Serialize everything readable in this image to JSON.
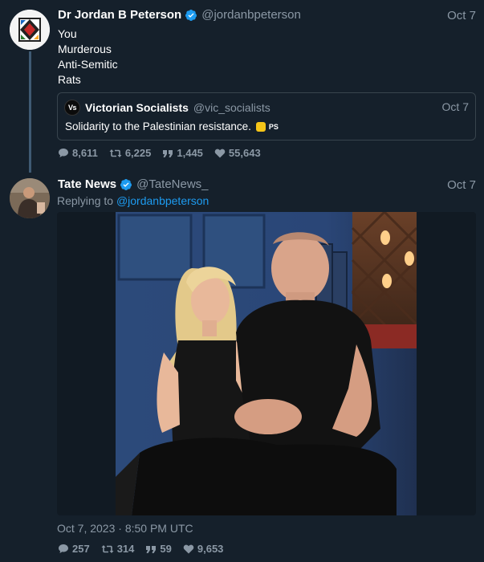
{
  "thread": [
    {
      "author": {
        "name": "Dr Jordan B Peterson",
        "handle": "@jordanbpeterson",
        "verified": true
      },
      "date": "Oct 7",
      "lines": [
        "You",
        "Murderous",
        "Anti-Semitic",
        "Rats"
      ],
      "quoted": {
        "logo_text": "Vs",
        "name": "Victorian Socialists",
        "handle": "@vic_socialists",
        "date": "Oct 7",
        "text": "Solidarity to the Palestinian resistance.",
        "suffix": "PS"
      },
      "stats": {
        "replies": "8,611",
        "retweets": "6,225",
        "quotes": "1,445",
        "likes": "55,643"
      }
    },
    {
      "author": {
        "name": "Tate News",
        "handle": "@TateNews_",
        "verified": true
      },
      "date": "Oct 7",
      "replying_label": "Replying to",
      "replying_to": "@jordanbpeterson",
      "timestamp": "Oct 7, 2023 · 8:50 PM UTC",
      "stats": {
        "replies": "257",
        "retweets": "314",
        "quotes": "59",
        "likes": "9,653"
      }
    }
  ],
  "colors": {
    "background": "#15202b",
    "muted": "#8b98a5",
    "link": "#1d9bf0",
    "border": "#38444d"
  },
  "icons": [
    "verified-badge-icon",
    "reply-icon",
    "retweet-icon",
    "quote-icon",
    "heart-icon"
  ]
}
